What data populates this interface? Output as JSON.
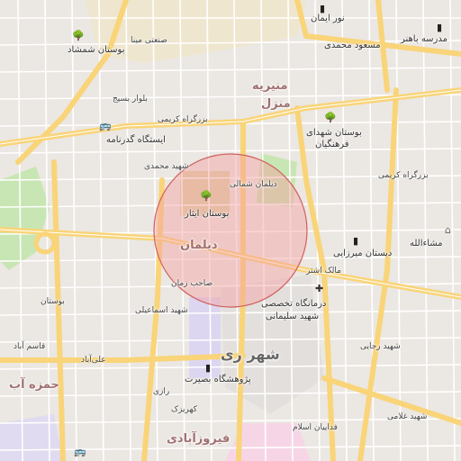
{
  "colors": {
    "background": "#f2efe9",
    "major_road": "#f9d478",
    "minor_road": "#ffffff",
    "park": "#c8e6b3",
    "plaza": "#dfd1a8",
    "highlight_fill": "#f4a0a0",
    "highlight_stroke": "#d06060",
    "residential": "#e6e1dc"
  },
  "icons": [
    "park-icon",
    "school-icon",
    "bus-stop-icon",
    "hospital-icon",
    "museum-icon",
    "place-of-worship-icon"
  ],
  "labels": {
    "nour_iman": "نور ایمان",
    "madreseh_bahonar": "مدرسه باهنر",
    "boostan_shamshad": "بوستان شمشاد",
    "masoud_mohammadi": "مسعود محمدی",
    "sanati_mina": "صنعتی مینا",
    "monirieh": "منیریه",
    "manzel": "منزل",
    "bolvar_basij": "بلوار بسیج",
    "bozorgrah_karimi": "بزرگراه کریمی",
    "istgah_gadarnameh": "ایستگاه گدرنامه",
    "boostan_shohadaye_farhangian_1": "بوستان شهدای",
    "boostan_shohadaye_farhangian_2": "فرهنگیان",
    "bozorgrah_karimi_east": "بزرگراه کریمی",
    "boostan_isar": "بوستان ایثار",
    "deilaman_area": "دیلمان",
    "deilaman_street": "دیلمان شمالی",
    "masoud_area": "مسعود",
    "mashallah": "مشاءالله",
    "dabestan_mirzaei": "دبستان میرزایی",
    "malek_ashtar": "مالک اشتر",
    "darmangah_1": "درمانگاه تخصصی",
    "darmangah_2": "شهید سلیمانی",
    "shahr_rey": "شهر ری",
    "pazhooheshgah": "پژوهشگاه بصیرت",
    "firoozabadi": "فیروزآبادی",
    "hamzeh": "حمزه آب",
    "ghasem_abad": "قاسم آباد",
    "sahab_zaman": "صاحب زمان",
    "shahid_gholami": "شهید غلامی",
    "fadaian_eslam": "فداییان اسلام",
    "boostan_west": "بوستان",
    "shahid_mohammadi": "شهید محمدی",
    "aliabad": "علی‌آباد",
    "razi": "رازی",
    "kahrizak": "کهریزک",
    "shahid_esmaeili": "شهید اسماعیلی",
    "shahid_rajaei": "شهید رجایی"
  }
}
